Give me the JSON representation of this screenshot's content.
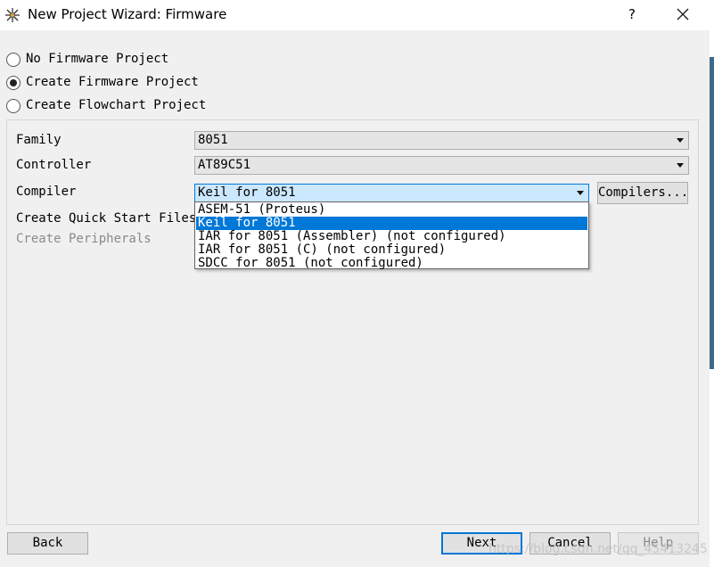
{
  "window": {
    "title": "New Project Wizard: Firmware",
    "help_label": "?",
    "icons": {
      "app": "proteus-app-icon",
      "close": "close-icon"
    }
  },
  "project_type": {
    "options": [
      {
        "label": "No Firmware Project",
        "checked": false
      },
      {
        "label": "Create Firmware Project",
        "checked": true
      },
      {
        "label": "Create Flowchart Project",
        "checked": false
      }
    ]
  },
  "form": {
    "family": {
      "label": "Family",
      "value": "8051"
    },
    "controller": {
      "label": "Controller",
      "value": "AT89C51"
    },
    "compiler": {
      "label": "Compiler",
      "value": "Keil for 8051",
      "button_label": "Compilers...",
      "options": [
        "ASEM-51 (Proteus)",
        "Keil for 8051",
        "IAR for 8051 (Assembler) (not configured)",
        "IAR for 8051 (C) (not configured)",
        "SDCC for 8051 (not configured)"
      ],
      "selected_index": 1
    },
    "quick_start": {
      "label": "Create Quick Start Files"
    },
    "peripherals": {
      "label": "Create Peripherals"
    }
  },
  "footer": {
    "back_label": "Back",
    "next_label": "Next",
    "cancel_label": "Cancel",
    "help_label": "Help"
  },
  "watermark": "https://blog.csdn.net/qq_45413245",
  "colors": {
    "selection": "#0078d7",
    "open_combo": "#cce8ff",
    "disabled_text": "#8a8a8a"
  }
}
